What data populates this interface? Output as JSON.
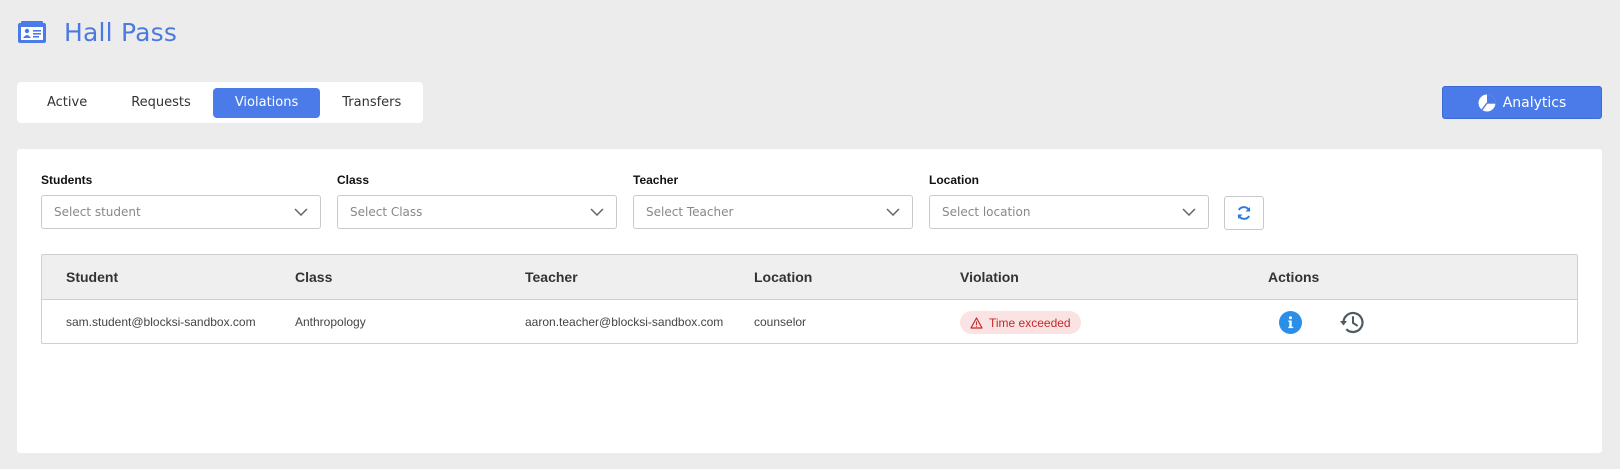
{
  "app": {
    "title": "Hall Pass",
    "logo_icon": "id-card-icon"
  },
  "tabs": [
    {
      "label": "Active",
      "active": false
    },
    {
      "label": "Requests",
      "active": false
    },
    {
      "label": "Violations",
      "active": true
    },
    {
      "label": "Transfers",
      "active": false
    }
  ],
  "analytics": {
    "label": "Analytics",
    "icon": "pie-chart-icon"
  },
  "filters": {
    "students": {
      "label": "Students",
      "placeholder": "Select student"
    },
    "class": {
      "label": "Class",
      "placeholder": "Select Class"
    },
    "teacher": {
      "label": "Teacher",
      "placeholder": "Select Teacher"
    },
    "location": {
      "label": "Location",
      "placeholder": "Select location"
    },
    "refresh_icon": "refresh-icon"
  },
  "table": {
    "columns": [
      "Student",
      "Class",
      "Teacher",
      "Location",
      "Violation",
      "Actions"
    ],
    "rows": [
      {
        "student": "sam.student@blocksi-sandbox.com",
        "class": "Anthropology",
        "teacher": "aaron.teacher@blocksi-sandbox.com",
        "location": "counselor",
        "violation": "Time exceeded",
        "actions": [
          "info-icon",
          "history-icon"
        ]
      }
    ]
  },
  "colors": {
    "accent": "#4a7be8",
    "violation_text": "#c62828",
    "violation_bg": "#fbe3e3",
    "info": "#2b8ee8"
  }
}
